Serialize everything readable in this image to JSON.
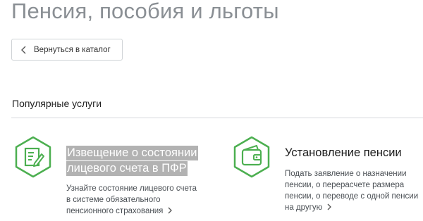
{
  "page": {
    "title": "Пенсия, пособия и льготы"
  },
  "back": {
    "label": "Вернуться в каталог",
    "icon": "chevron-left-icon"
  },
  "popular": {
    "title": "Популярные услуги"
  },
  "cards": [
    {
      "icon": "document-edit-icon",
      "title_lines": [
        "Извещение о состоянии",
        "лицевого счета в ПФР"
      ],
      "title_highlighted": true,
      "desc_lines": [
        "Узнайте состояние лицевого счета",
        "в системе обязательного",
        "пенсионного страхования"
      ]
    },
    {
      "icon": "wallet-icon",
      "title_lines": [
        "Установление пенсии"
      ],
      "desc_lines": [
        "Подать заявление о назначении",
        "пенсии, о перерасчете размера",
        "пенсии, о переводе с одной пенсии",
        "на другую"
      ]
    }
  ],
  "colors": {
    "accent_green": "#4caf50",
    "title_grey": "#8a8f94",
    "highlight_grey": "#b2b2b2"
  }
}
